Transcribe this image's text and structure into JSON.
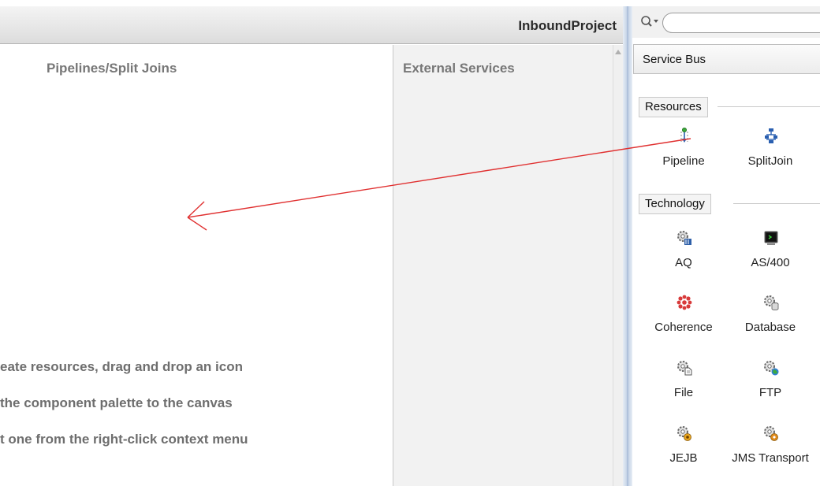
{
  "canvas": {
    "project_title": "InboundProject",
    "lanes": {
      "pipelines": "Pipelines/Split Joins",
      "external_services": "External Services"
    },
    "hint_lines": [
      "eate resources, drag and drop an icon",
      "the component palette to the canvas",
      "t one from the right-click context menu"
    ]
  },
  "palette": {
    "search": {
      "value": "",
      "placeholder": ""
    },
    "library": "Service Bus",
    "sections": [
      {
        "label": "Resources",
        "items": [
          {
            "label": "Pipeline",
            "icon": "pipeline-icon"
          },
          {
            "label": "SplitJoin",
            "icon": "splitjoin-icon"
          }
        ]
      },
      {
        "label": "Technology",
        "items": [
          {
            "label": "AQ",
            "icon": "aq-gear-icon"
          },
          {
            "label": "AS/400",
            "icon": "as400-terminal-icon"
          },
          {
            "label": "Coherence",
            "icon": "coherence-icon"
          },
          {
            "label": "Database",
            "icon": "database-gear-icon"
          },
          {
            "label": "File",
            "icon": "file-gear-icon"
          },
          {
            "label": "FTP",
            "icon": "ftp-gear-icon"
          },
          {
            "label": "JEJB",
            "icon": "jejb-gear-icon"
          },
          {
            "label": "JMS Transport",
            "icon": "jms-gear-icon"
          }
        ]
      }
    ]
  },
  "colors": {
    "drag_arrow": "#e03030",
    "splitter": "#9fb5d3",
    "lane_background": "#f2f2f2"
  }
}
